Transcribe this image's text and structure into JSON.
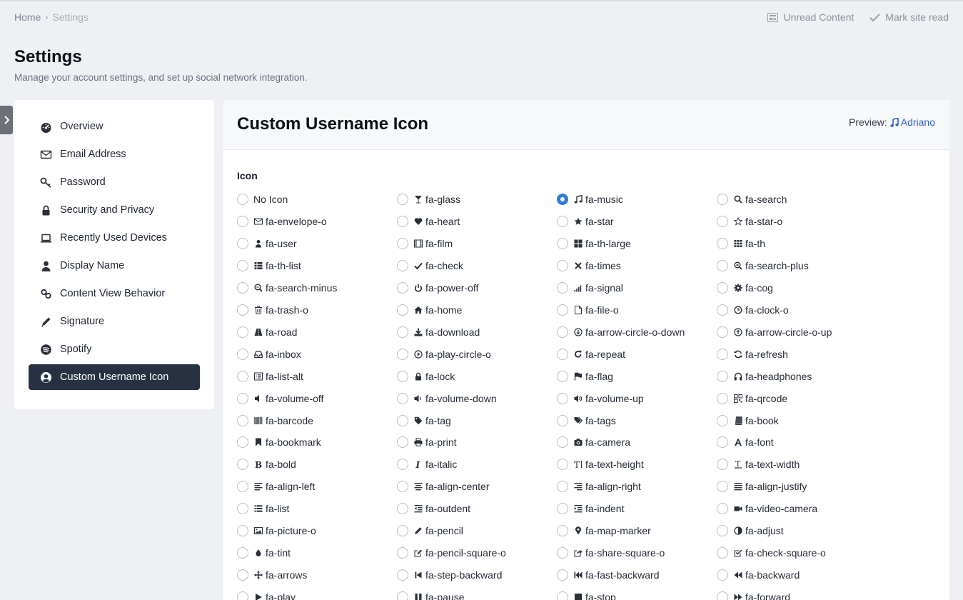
{
  "breadcrumb": {
    "home": "Home",
    "current": "Settings"
  },
  "topnav": {
    "unread": "Unread Content",
    "mark_read": "Mark site read"
  },
  "page": {
    "title": "Settings",
    "subtitle": "Manage your account settings, and set up social network integration."
  },
  "sidebar": {
    "items": [
      {
        "label": "Overview",
        "icon": "dashboard-icon"
      },
      {
        "label": "Email Address",
        "icon": "envelope-icon"
      },
      {
        "label": "Password",
        "icon": "key-icon"
      },
      {
        "label": "Security and Privacy",
        "icon": "lock-icon"
      },
      {
        "label": "Recently Used Devices",
        "icon": "laptop-icon"
      },
      {
        "label": "Display Name",
        "icon": "user-icon"
      },
      {
        "label": "Content View Behavior",
        "icon": "link-icon"
      },
      {
        "label": "Signature",
        "icon": "pencil-icon"
      },
      {
        "label": "Spotify",
        "icon": "spotify-icon"
      },
      {
        "label": "Custom Username Icon",
        "icon": "user-circle-icon",
        "active": true
      }
    ]
  },
  "panel": {
    "title": "Custom Username Icon",
    "preview_label": "Preview:",
    "preview_user": "Adriano",
    "field_label": "Icon",
    "selected": "fa-music",
    "options": [
      "No Icon",
      "fa-glass",
      "fa-music",
      "fa-search",
      "fa-envelope-o",
      "fa-heart",
      "fa-star",
      "fa-star-o",
      "fa-user",
      "fa-film",
      "fa-th-large",
      "fa-th",
      "fa-th-list",
      "fa-check",
      "fa-times",
      "fa-search-plus",
      "fa-search-minus",
      "fa-power-off",
      "fa-signal",
      "fa-cog",
      "fa-trash-o",
      "fa-home",
      "fa-file-o",
      "fa-clock-o",
      "fa-road",
      "fa-download",
      "fa-arrow-circle-o-down",
      "fa-arrow-circle-o-up",
      "fa-inbox",
      "fa-play-circle-o",
      "fa-repeat",
      "fa-refresh",
      "fa-list-alt",
      "fa-lock",
      "fa-flag",
      "fa-headphones",
      "fa-volume-off",
      "fa-volume-down",
      "fa-volume-up",
      "fa-qrcode",
      "fa-barcode",
      "fa-tag",
      "fa-tags",
      "fa-book",
      "fa-bookmark",
      "fa-print",
      "fa-camera",
      "fa-font",
      "fa-bold",
      "fa-italic",
      "fa-text-height",
      "fa-text-width",
      "fa-align-left",
      "fa-align-center",
      "fa-align-right",
      "fa-align-justify",
      "fa-list",
      "fa-outdent",
      "fa-indent",
      "fa-video-camera",
      "fa-picture-o",
      "fa-pencil",
      "fa-map-marker",
      "fa-adjust",
      "fa-tint",
      "fa-pencil-square-o",
      "fa-share-square-o",
      "fa-check-square-o",
      "fa-arrows",
      "fa-step-backward",
      "fa-fast-backward",
      "fa-backward",
      "fa-play",
      "fa-pause",
      "fa-stop",
      "fa-forward"
    ]
  },
  "colors": {
    "accent": "#2b7cd3",
    "sidebar_active": "#283142",
    "link": "#2d5fc4"
  }
}
